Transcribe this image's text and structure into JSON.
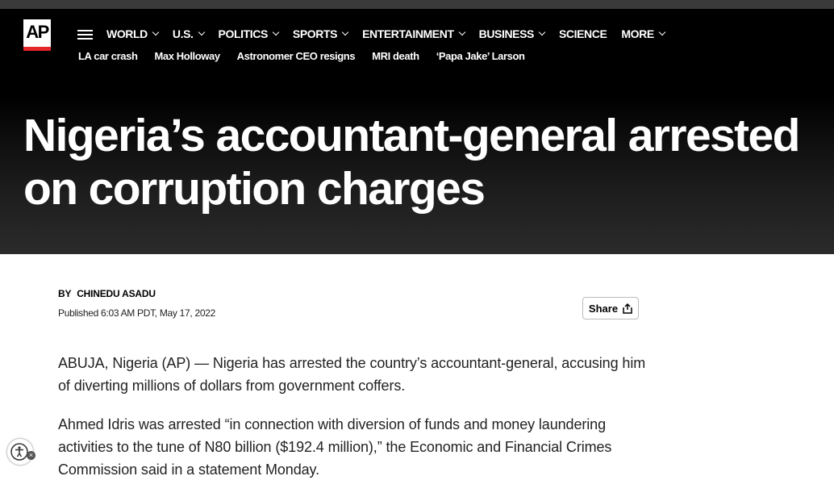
{
  "brand": {
    "logo_text": "AP",
    "accent_color": "#e4262c"
  },
  "nav": {
    "menu_icon": "hamburger-icon",
    "items": [
      {
        "label": "WORLD",
        "has_dropdown": true
      },
      {
        "label": "U.S.",
        "has_dropdown": true
      },
      {
        "label": "POLITICS",
        "has_dropdown": true
      },
      {
        "label": "SPORTS",
        "has_dropdown": true
      },
      {
        "label": "ENTERTAINMENT",
        "has_dropdown": true
      },
      {
        "label": "BUSINESS",
        "has_dropdown": true
      },
      {
        "label": "SCIENCE",
        "has_dropdown": false
      },
      {
        "label": "MORE",
        "has_dropdown": true
      }
    ]
  },
  "trending": [
    "LA car crash",
    "Max Holloway",
    "Astronomer CEO resigns",
    "MRI death",
    "‘Papa Jake’ Larson"
  ],
  "article": {
    "headline": "Nigeria’s accountant-general arrested on corruption charges",
    "byline_prefix": "BY",
    "author": "CHINEDU ASADU",
    "published": "Published 6:03 AM PDT, May 17, 2022",
    "share_label": "Share",
    "paragraphs": [
      "ABUJA, Nigeria (AP) — Nigeria has arrested the country’s accountant-general, accusing him of diverting millions of dollars from government coffers.",
      "Ahmed Idris was arrested “in connection with diversion of funds and money laundering activities to the tune of N80 billion ($192.4 million),” the Economic and Financial Crimes Commission said in a statement Monday."
    ]
  },
  "accessibility": {
    "icon": "accessibility-icon",
    "close_icon": "close-icon"
  }
}
